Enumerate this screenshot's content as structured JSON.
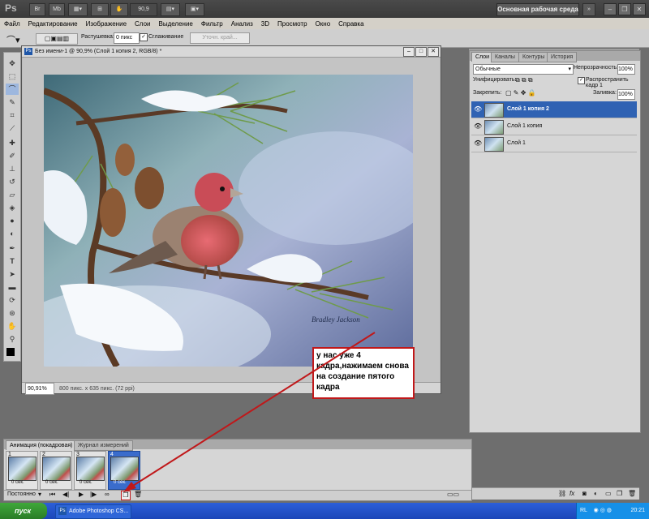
{
  "app": {
    "logo": "Ps",
    "zoom": "90,9",
    "workspace": "Основная рабочая среда",
    "btn_br": "Br",
    "btn_mb": "Mb"
  },
  "menu": [
    "Файл",
    "Редактирование",
    "Изображение",
    "Слои",
    "Выделение",
    "Фильтр",
    "Анализ",
    "3D",
    "Просмотр",
    "Окно",
    "Справка"
  ],
  "options": {
    "feather_label": "Растушевка:",
    "feather_value": "0 пикс",
    "antialias_label": "Сглаживание",
    "refine_label": "Уточн. край..."
  },
  "document": {
    "title": "Без имени-1 @ 90,9% (Слой 1 копия 2, RGB/8) *",
    "zoom": "90,91%",
    "size": "800 пикс. x 635 пикс. (72 ppi)",
    "signature": "Bradley Jackson"
  },
  "layers_panel": {
    "tabs": [
      "Слои",
      "Каналы",
      "Контуры",
      "История"
    ],
    "blend": "Обычные",
    "opacity_label": "Непрозрачность:",
    "opacity_value": "100%",
    "unify_label": "Унифицировать:",
    "propagate_label": "Распространить кадр 1",
    "lock_label": "Закрепить:",
    "fill_label": "Заливка:",
    "fill_value": "100%",
    "layers": [
      {
        "name": "Слой 1 копия 2",
        "selected": true
      },
      {
        "name": "Слой 1 копия",
        "selected": false
      },
      {
        "name": "Слой 1",
        "selected": false
      }
    ]
  },
  "animation": {
    "tabs": [
      "Анимация (покадровая)",
      "Журнал измерений"
    ],
    "frames": [
      {
        "num": "1",
        "delay": "0 сек."
      },
      {
        "num": "2",
        "delay": "0 сек."
      },
      {
        "num": "3",
        "delay": "0 сек."
      },
      {
        "num": "4",
        "delay": "0 сек."
      }
    ],
    "loop": "Постоянно"
  },
  "annotation": "у нас  уже 4 кадра,нажимаем снова на создание пятого кадра",
  "taskbar": {
    "start": "пуск",
    "item": "Adobe Photoshop CS...",
    "lang": "RL",
    "time": "20:21"
  },
  "colors": {
    "accent": "#2f62b3",
    "annotation_border": "#c0181a",
    "arrow": "#c0181a"
  }
}
